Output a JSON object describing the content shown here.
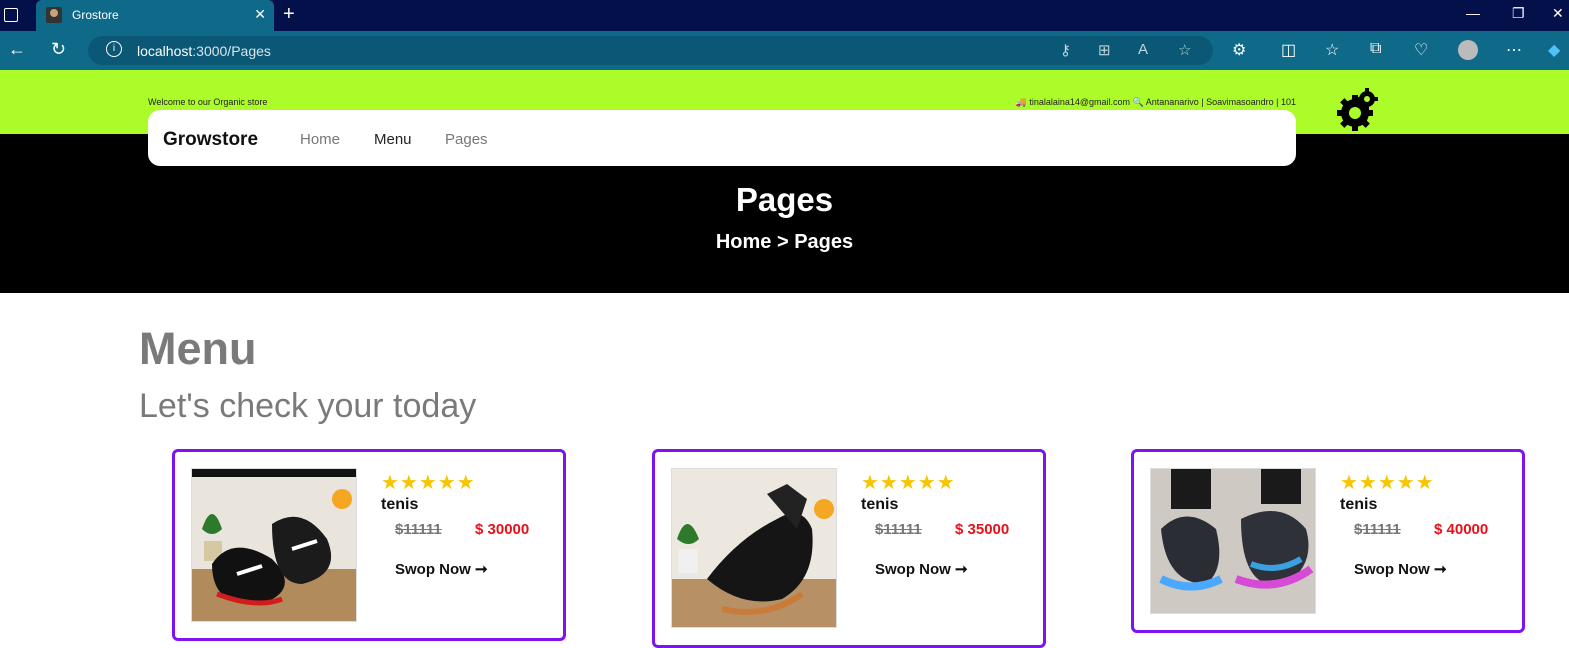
{
  "browser": {
    "tab_title": "Grostore",
    "url_host": "localhost",
    "url_rest": ":3000/Pages"
  },
  "site": {
    "welcome": "Welcome to our Organic store",
    "contact": "tinalalaina14@gmail.com",
    "location": "Antananarivo | Soavimasoandro | 101",
    "brand": "Growstore",
    "nav": [
      "Home",
      "Menu",
      "Pages"
    ],
    "hero_title": "Pages",
    "breadcrumb_home": "Home",
    "breadcrumb_sep": ">",
    "breadcrumb_current": "Pages"
  },
  "section": {
    "title": "Menu",
    "subtitle": "Let's check your today"
  },
  "products": [
    {
      "name": "tenis",
      "old_price": "$11111",
      "price": "$ 30000",
      "rating": 5,
      "button": "Swop Now ➞"
    },
    {
      "name": "tenis",
      "old_price": "$11111",
      "price": "$ 35000",
      "rating": 5,
      "button": "Swop Now ➞"
    },
    {
      "name": "tenis",
      "old_price": "$11111",
      "price": "$ 40000",
      "rating": 5,
      "button": "Swop Now ➞"
    }
  ],
  "colors": {
    "accent_green": "#acfc2a",
    "card_border": "#7e12f0",
    "price_red": "#e8101a",
    "star": "#f7c600"
  }
}
